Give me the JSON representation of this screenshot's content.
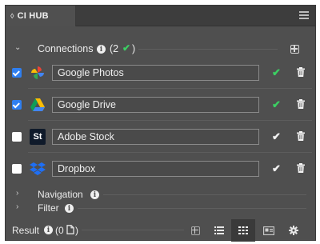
{
  "panel": {
    "tab_label": "CI HUB"
  },
  "connections": {
    "title": "Connections",
    "count_text": "(2",
    "items": [
      {
        "name": "Google Photos",
        "checked": true,
        "status": "ok"
      },
      {
        "name": "Google Drive",
        "checked": true,
        "status": "ok"
      },
      {
        "name": "Adobe Stock",
        "checked": false,
        "status": "plain"
      },
      {
        "name": "Dropbox",
        "checked": false,
        "status": "plain"
      }
    ]
  },
  "navigation": {
    "title": "Navigation"
  },
  "filter": {
    "title": "Filter"
  },
  "result": {
    "title": "Result",
    "count_text": "(0"
  },
  "icons": {
    "panel_menu": "hamburger-icon",
    "add_connection": "plus-square-icon",
    "delete": "trash-icon",
    "views": [
      "add-square-icon",
      "list-view-icon",
      "grid-view-icon",
      "card-view-icon",
      "gear-icon"
    ]
  },
  "colors": {
    "accent_green": "#3ccf63",
    "checkbox_blue": "#2f7ff0",
    "panel_bg": "#4f4f4f"
  }
}
